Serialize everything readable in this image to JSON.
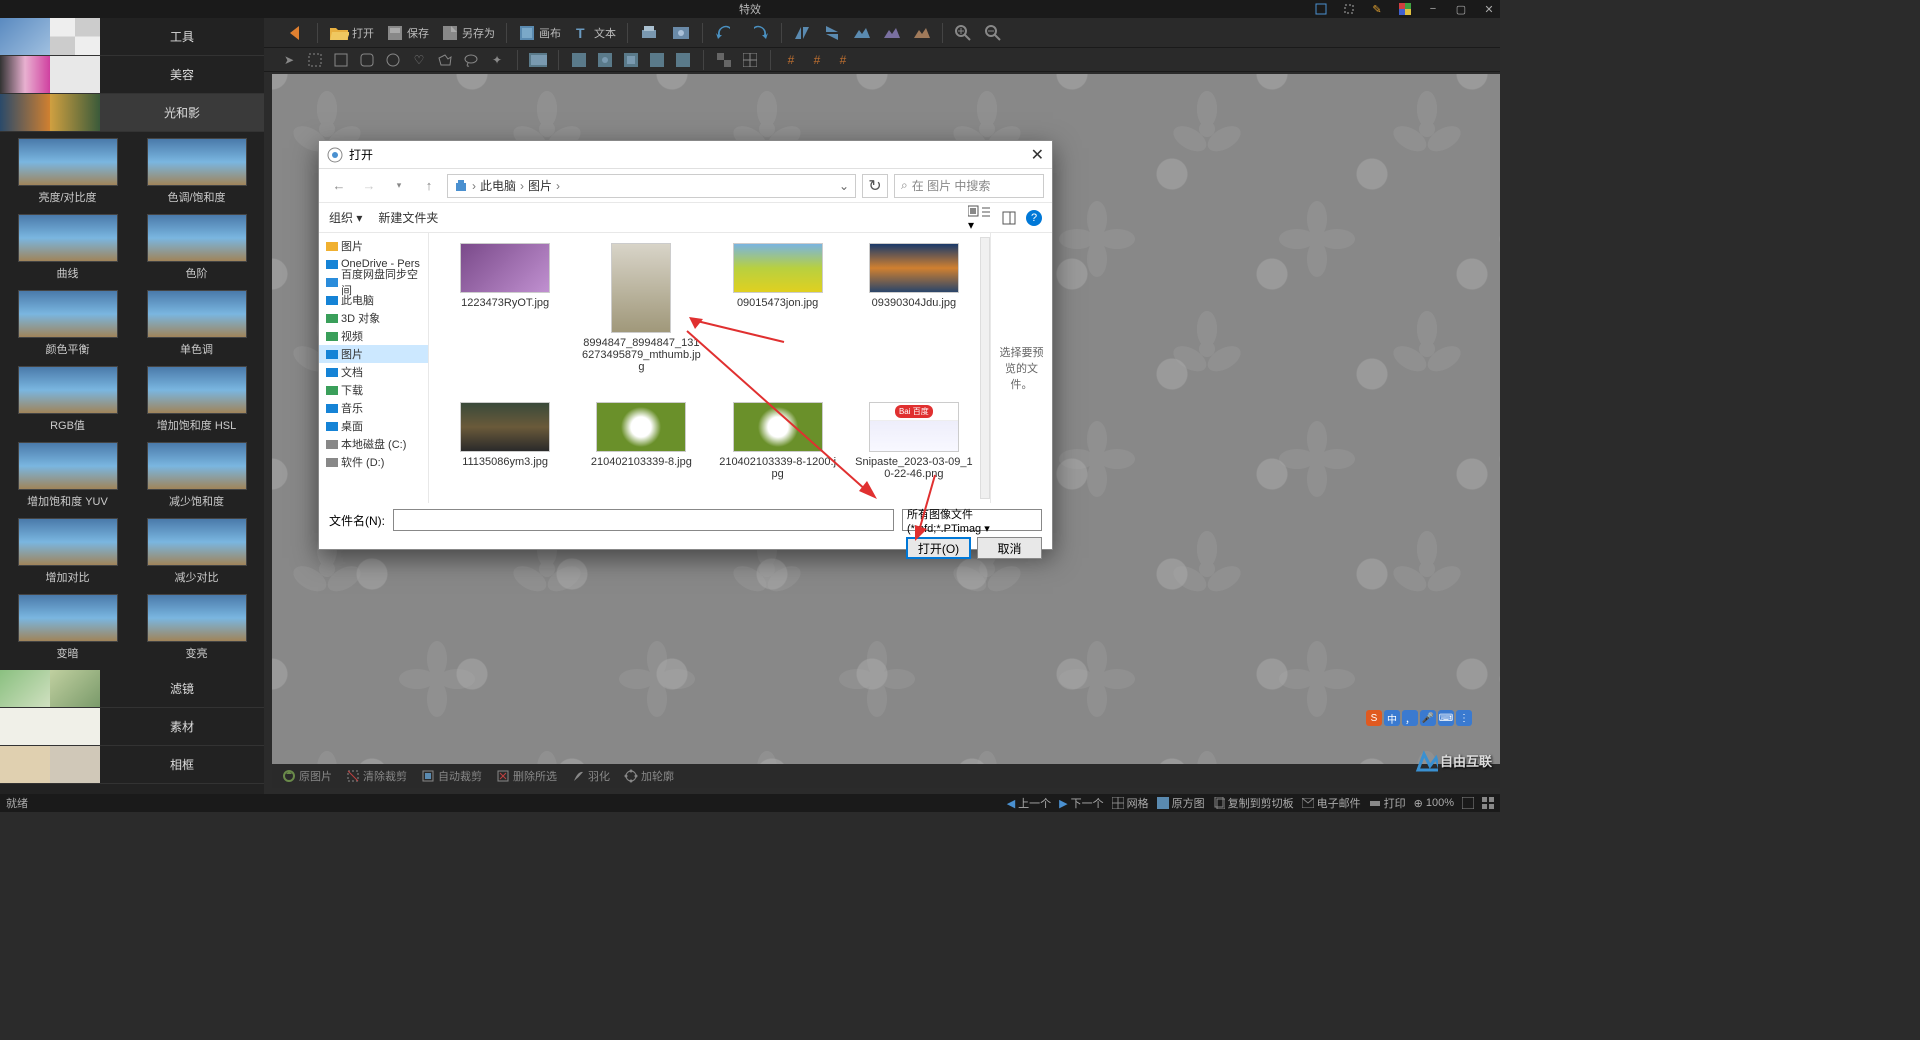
{
  "titlebar": {
    "title": "特效"
  },
  "toolbar": {
    "open": "打开",
    "save": "保存",
    "saveas": "另存为",
    "canvas": "画布",
    "text": "文本"
  },
  "sidebar_cats": {
    "tools": "工具",
    "beauty": "美容",
    "light_shadow": "光和影",
    "filter": "滤镜",
    "material": "素材",
    "frame": "相框"
  },
  "effects": [
    [
      "亮度/对比度",
      "色调/饱和度"
    ],
    [
      "曲线",
      "色阶"
    ],
    [
      "颜色平衡",
      "单色调"
    ],
    [
      "RGB值",
      "增加饱和度 HSL"
    ],
    [
      "增加饱和度 YUV",
      "减少饱和度"
    ],
    [
      "增加对比",
      "减少对比"
    ],
    [
      "变暗",
      "变亮"
    ]
  ],
  "dialog": {
    "title": "打开",
    "breadcrumb": [
      "此电脑",
      "图片"
    ],
    "search_placeholder": "在 图片 中搜索",
    "organize": "组织 ▾",
    "new_folder": "新建文件夹",
    "tree": [
      {
        "label": "图片",
        "icon": "folder",
        "color": "#f0b030"
      },
      {
        "label": "OneDrive - Pers",
        "icon": "cloud",
        "color": "#1583d6"
      },
      {
        "label": "百度网盘同步空间",
        "icon": "baidu",
        "color": "#2a8cdb"
      },
      {
        "label": "此电脑",
        "icon": "pc",
        "color": "#1583d6"
      },
      {
        "label": "3D 对象",
        "icon": "3d",
        "color": "#3a9f5a"
      },
      {
        "label": "视频",
        "icon": "video",
        "color": "#3a9f5a"
      },
      {
        "label": "图片",
        "icon": "pic",
        "color": "#1583d6",
        "sel": true
      },
      {
        "label": "文档",
        "icon": "doc",
        "color": "#1583d6"
      },
      {
        "label": "下载",
        "icon": "dl",
        "color": "#3a9f5a"
      },
      {
        "label": "音乐",
        "icon": "music",
        "color": "#1583d6"
      },
      {
        "label": "桌面",
        "icon": "desk",
        "color": "#1583d6"
      },
      {
        "label": "本地磁盘 (C:)",
        "icon": "disk",
        "color": "#888"
      },
      {
        "label": "软件 (D:)",
        "icon": "disk",
        "color": "#888"
      }
    ],
    "files": [
      {
        "name": "1223473RyOT.jpg",
        "bg": "linear-gradient(135deg,#7a4a8a,#c090d0)"
      },
      {
        "name": "8994847_8994847_1316273495879_mthumb.jpg",
        "bg": "linear-gradient(180deg,#d8d4c8,#a0987a)",
        "tall": true
      },
      {
        "name": "09015473jon.jpg",
        "bg": "linear-gradient(180deg,#7ab4e0,#b8d040,#e0d020)"
      },
      {
        "name": "09390304Jdu.jpg",
        "bg": "linear-gradient(180deg,#1a3a6a,#d08030,#2a456a)"
      },
      {
        "name": "11135086ym3.jpg",
        "bg": "linear-gradient(180deg,#3a4a3a,#6a5a3a,#2a2a2a)"
      },
      {
        "name": "210402103339-8.jpg",
        "bg": "radial-gradient(circle,#fff 20%,#6a902a 40%)"
      },
      {
        "name": "210402103339-8-1200.jpg",
        "bg": "radial-gradient(circle,#fff 20%,#6a902a 40%)"
      },
      {
        "name": "Snipaste_2023-03-09_10-22-46.png",
        "bg": "linear-gradient(180deg,#e8e8f8,#f8f8ff)"
      }
    ],
    "preview_hint": "选择要预览的文件。",
    "filename_label": "文件名(N):",
    "filter": "所有图像文件 (*.pfd;*.PTimag ▾",
    "open_btn": "打开(O)",
    "cancel_btn": "取消"
  },
  "bottom": {
    "reset": "原图片",
    "clear": "清除裁剪",
    "auto": "自动裁剪",
    "effects": "删除所选",
    "feather": "羽化",
    "addpts": "加轮廓"
  },
  "status": {
    "ready": "就绪",
    "prev": "上一个",
    "next": "下一个",
    "grid": "网格",
    "orig": "原方图",
    "copy": "复制到剪切板",
    "mail": "电子邮件",
    "print": "打印",
    "zoom": "100%"
  },
  "watermark": "自由互联"
}
